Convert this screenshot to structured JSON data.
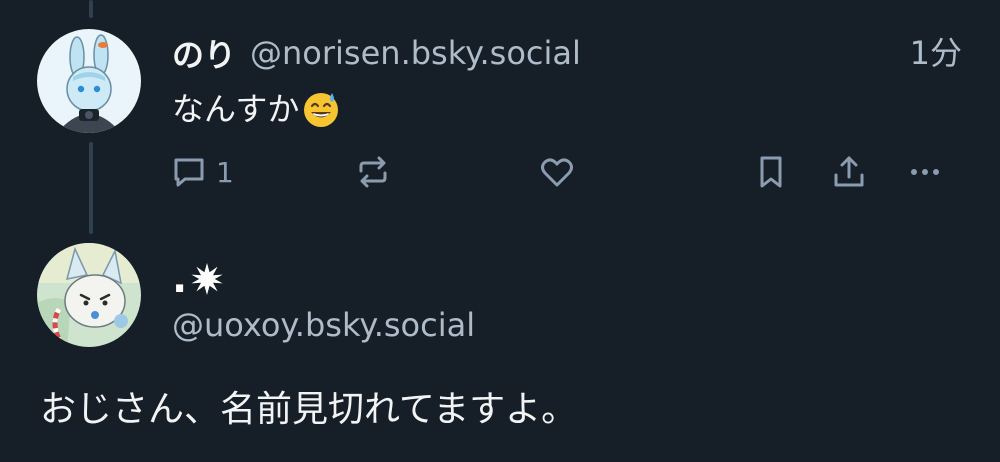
{
  "post": {
    "display_name": "のり",
    "handle": "@norisen.bsky.social",
    "time": "1分",
    "text": "なんすか",
    "emoji": "sweat-smile-emoji",
    "reply_count": "1"
  },
  "reply": {
    "display_name": ".✹",
    "display_name_prefix": ".",
    "display_name_symbol": "✹",
    "handle": "@uoxoy.bsky.social",
    "text": "おじさん、名前見切れてますよ。"
  },
  "icons": {
    "reply": "speech-bubble-icon",
    "repost": "repost-arrows-icon",
    "like": "heart-icon",
    "bookmark": "bookmark-icon",
    "share": "share-upload-icon",
    "more": "more-dots-icon"
  },
  "colors": {
    "background": "#161e27",
    "thread_line": "#2e4052",
    "muted_text": "#aebbc9",
    "icon": "#8b9cb0",
    "primary_text": "#f1f3f5"
  }
}
